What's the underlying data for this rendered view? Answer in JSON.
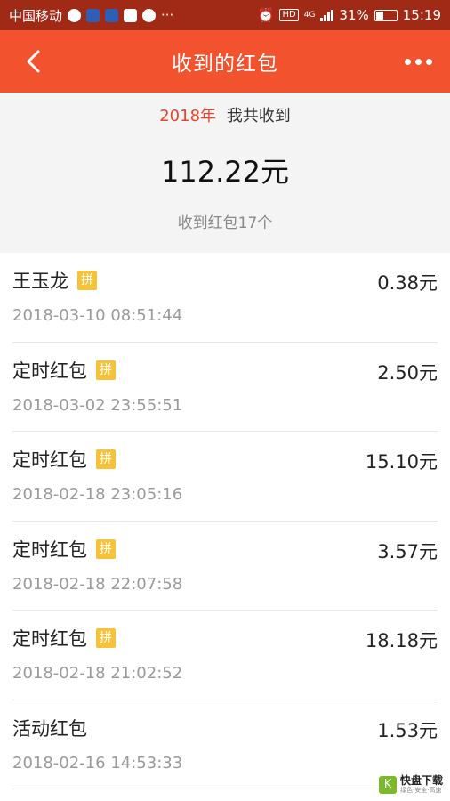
{
  "status_bar": {
    "carrier": "中国移动",
    "network": "4G",
    "battery": "31%",
    "time": "15:19",
    "hd_badge": "HD",
    "ellipsis": "···"
  },
  "header": {
    "title": "收到的红包",
    "back_icon": "chevron-left-icon",
    "more_icon": "more-horizontal-icon"
  },
  "summary": {
    "year": "2018年",
    "year_suffix": "我共收到",
    "total": "112.22元",
    "count_text": "收到红包17个"
  },
  "pin_badge": "拼",
  "records": [
    {
      "name": "王玉龙",
      "pinned": true,
      "amount": "0.38元",
      "time": "2018-03-10 08:51:44"
    },
    {
      "name": "定时红包",
      "pinned": true,
      "amount": "2.50元",
      "time": "2018-03-02 23:55:51"
    },
    {
      "name": "定时红包",
      "pinned": true,
      "amount": "15.10元",
      "time": "2018-02-18 23:05:16"
    },
    {
      "name": "定时红包",
      "pinned": true,
      "amount": "3.57元",
      "time": "2018-02-18 22:07:58"
    },
    {
      "name": "定时红包",
      "pinned": true,
      "amount": "18.18元",
      "time": "2018-02-18 21:02:52"
    },
    {
      "name": "活动红包",
      "pinned": false,
      "amount": "1.53元",
      "time": "2018-02-16 14:53:33"
    }
  ],
  "watermark": {
    "logo_char": "K",
    "name": "快盘下载",
    "tagline": "绿色·安全·高速"
  },
  "colors": {
    "header": "#f2522e",
    "status_bar": "#a12a17",
    "accent_year": "#e8452c",
    "pin_badge": "#f5c23a"
  }
}
